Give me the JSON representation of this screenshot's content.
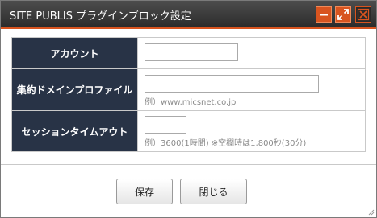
{
  "dialog": {
    "title": "SITE PUBLIS プラグインブロック設定"
  },
  "form": {
    "account": {
      "label": "アカウント",
      "value": ""
    },
    "domain_profile": {
      "label": "集約ドメインプロファイル",
      "value": "",
      "hint": "例）www.micsnet.co.jp"
    },
    "session_timeout": {
      "label": "セッションタイムアウト",
      "value": "",
      "hint": "例）3600(1時間) ※空欄時は1,800秒(30分)"
    }
  },
  "buttons": {
    "save_label": "保存",
    "close_label": "閉じる"
  },
  "colors": {
    "accent": "#d8541f",
    "header_bg": "#283346",
    "titlebar_bg": "#333333"
  },
  "icons": {
    "minimize": "minimize-icon",
    "maximize": "maximize-icon",
    "close": "close-icon"
  }
}
